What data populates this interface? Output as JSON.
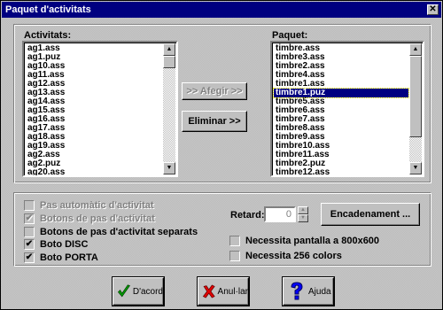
{
  "window": {
    "title": "Paquet d'activitats",
    "close_glyph": "✕"
  },
  "activitats": {
    "label": "Activitats:",
    "items": [
      "ag1.ass",
      "ag1.puz",
      "ag10.ass",
      "ag11.ass",
      "ag12.ass",
      "ag13.ass",
      "ag14.ass",
      "ag15.ass",
      "ag16.ass",
      "ag17.ass",
      "ag18.ass",
      "ag19.ass",
      "ag2.ass",
      "ag2.puz",
      "ag20.ass"
    ]
  },
  "paquet": {
    "label": "Paquet:",
    "items": [
      "timbre.ass",
      "timbre3.ass",
      "timbre2.ass",
      "timbre4.ass",
      "timbre1.ass",
      "timbre1.puz",
      "timbre5.ass",
      "timbre6.ass",
      "timbre7.ass",
      "timbre8.ass",
      "timbre9.ass",
      "timbre10.ass",
      "timbre11.ass",
      "timbre2.puz",
      "timbre12.ass"
    ],
    "selected_index": 5
  },
  "buttons": {
    "afegir": ">> Afegir >>",
    "eliminar": "Eliminar >>",
    "encadenament": "Encadenament ..."
  },
  "options": {
    "pas_automatic": {
      "label": "Pas automàtic d'activitat",
      "checked": false
    },
    "botons_pas": {
      "label": "Botons de pas d'activitat",
      "checked": true
    },
    "botons_separats": {
      "label": "Botons de pas d'activitat separats",
      "checked": false
    },
    "boto_disc": {
      "label": "Boto DISC",
      "checked": true
    },
    "boto_porta": {
      "label": "Boto PORTA",
      "checked": true
    },
    "pantalla": {
      "label": "Necessita pantalla a 800x600",
      "checked": false
    },
    "colors": {
      "label": "Necessita 256 colors",
      "checked": false
    }
  },
  "retard": {
    "label": "Retard:",
    "value": "0"
  },
  "footer": {
    "ok": {
      "label": "D'acord",
      "icon": "check-icon",
      "color": "#00a000"
    },
    "cancel": {
      "label": "Anul·lar",
      "icon": "x-icon",
      "color": "#e00000"
    },
    "help": {
      "label": "Ajuda",
      "icon": "question-icon",
      "color": "#0000ff"
    }
  }
}
